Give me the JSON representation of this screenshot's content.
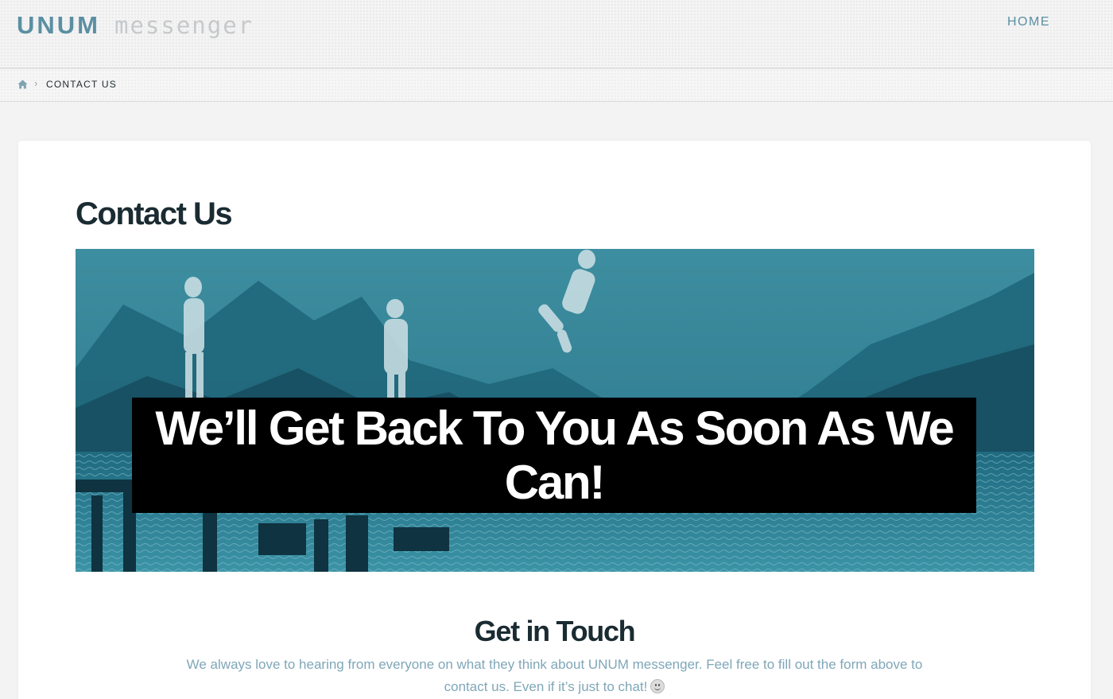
{
  "header": {
    "logo_primary": "UNUM",
    "logo_secondary": "messenger",
    "nav_home": "HOME"
  },
  "breadcrumb": {
    "home_icon": "home-icon",
    "separator": "›",
    "current": "CONTACT US"
  },
  "main": {
    "page_title": "Contact Us",
    "hero_caption": "We’ll Get Back To You As Soon As We Can!",
    "section_title": "Get in Touch",
    "intro_text": "We always love to hearing from everyone on what they think about UNUM messenger. Feel free to fill out the form above to contact us. Even if it’s just to chat!",
    "intro_emoji": "smiley-icon"
  },
  "colors": {
    "accent": "#5b8fa3",
    "heading": "#1a2b32",
    "body_text": "#7fa7b8",
    "hero_tint": "#2b7a8c",
    "caption_bg": "#000000"
  }
}
